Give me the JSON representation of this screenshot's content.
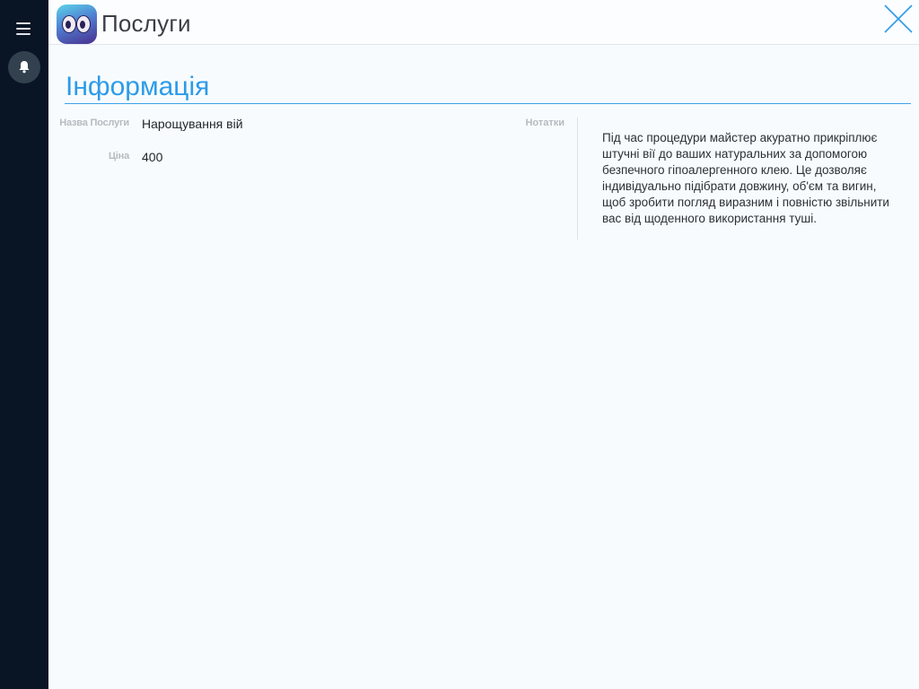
{
  "header": {
    "title": "Послуги"
  },
  "sidebar": {
    "menu_icon": "hamburger-menu-icon",
    "bell_icon": "bell-icon"
  },
  "section": {
    "title": "Інформація"
  },
  "fields": {
    "service_name_label": "Назва Послуги",
    "service_name_value": "Нарощування вій",
    "price_label": "Ціна",
    "price_value": "400"
  },
  "notes": {
    "label": "Нотатки",
    "text": "Під час процедури майстер акуратно прикріплює штучні вії до ваших натуральних за допомогою безпечного гіпоалергенного клею. Це дозволяє індивідуально підібрати довжину, об'єм та вигин, щоб зробити погляд виразним і повністю звільнити вас від щоденного використання туші."
  },
  "colors": {
    "sidebar": "#091525",
    "accent": "#2c9be8",
    "background": "#f7fbfd"
  }
}
